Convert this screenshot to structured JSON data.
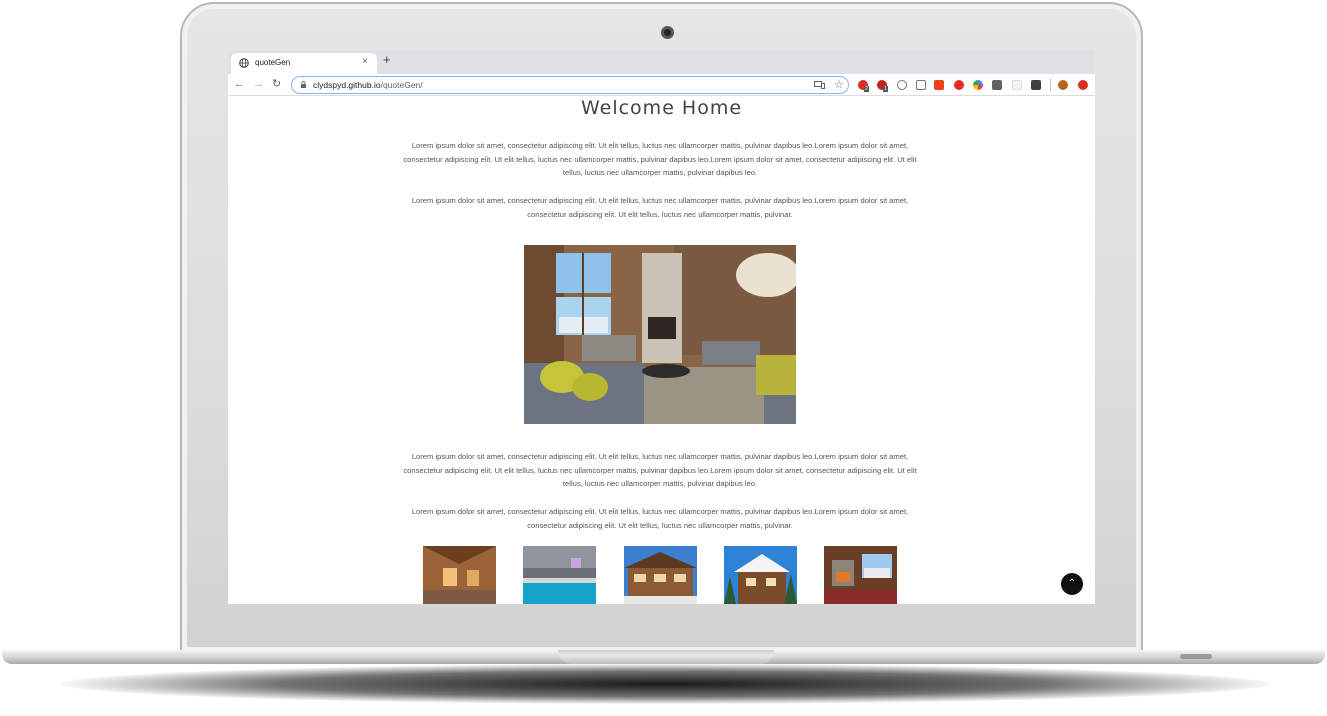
{
  "browser": {
    "tab_title": "quoteGen",
    "tab_close": "×",
    "new_tab": "+",
    "nav": {
      "back": "←",
      "forward": "→",
      "reload": "↻"
    },
    "url_host": "clydspyd.github.io",
    "url_path": "/quoteGen/",
    "bookmark_star": "☆",
    "extension_badges": [
      "2",
      "1"
    ]
  },
  "page": {
    "title": "Welcome Home",
    "intro_1": "Lorem ipsum dolor sit amet, consectetur adipiscing elit. Ut elit tellus, luctus nec ullamcorper mattis, pulvinar dapibus leo.Lorem ipsum dolor sit amet, consectetur adipiscing elit. Ut elit tellus, luctus nec ullamcorper mattis, pulvinar dapibus leo.Lorem ipsum dolor sit amet, consectetur adipiscing elit. Ut elit tellus, luctus nec ullamcorper mattis, pulvinar dapibus leo.",
    "intro_2": "Lorem ipsum dolor sit amet, consectetur adipiscing elit. Ut elit tellus, luctus nec ullamcorper mattis, pulvinar dapibus leo.Lorem ipsum dolor sit amet, consectetur adipiscing elit. Ut elit tellus, luctus nec ullamcorper mattis, pulvinar.",
    "body_1": "Lorem ipsum dolor sit amet, consectetur adipiscing elit. Ut elit tellus, luctus nec ullamcorper mattis, pulvinar dapibus leo.Lorem ipsum dolor sit amet, consectetur adipiscing elit. Ut elit tellus, luctus nec ullamcorper mattis, pulvinar dapibus leo.Lorem ipsum dolor sit amet, consectetur adipiscing elit. Ut elit tellus, luctus nec ullamcorper mattis, pulvinar dapibus leo.",
    "body_2": "Lorem ipsum dolor sit amet, consectetur adipiscing elit. Ut elit tellus, luctus nec ullamcorper mattis, pulvinar dapibus leo.Lorem ipsum dolor sit amet, consectetur adipiscing elit. Ut elit tellus, luctus nec ullamcorper mattis, pulvinar.",
    "hero_image": "chalet-living-room-photo",
    "gallery": [
      "chalet-interior-photo",
      "indoor-pool-photo",
      "chalet-exterior-photo",
      "snowy-chalet-photo",
      "fireplace-lounge-photo"
    ],
    "scroll_top_icon": "chevron-up-icon",
    "scroll_top_glyph": "⌃"
  },
  "colors": {
    "title": "#3f4450",
    "text": "#555555",
    "tab_bar": "#dee1e6",
    "omnibox_focus": "#8ab4f8"
  }
}
